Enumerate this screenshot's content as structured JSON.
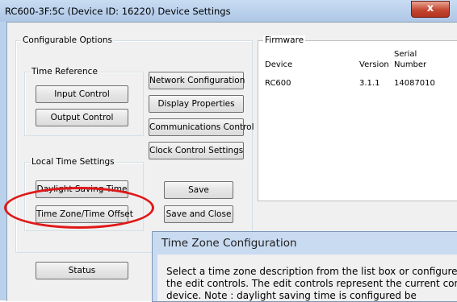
{
  "window": {
    "title": "RC600-3F:5C (Device ID: 16220) Device Settings",
    "close_glyph": "x"
  },
  "configurable_options": {
    "label": "Configurable Options"
  },
  "time_reference": {
    "label": "Time Reference",
    "input_control": "Input Control",
    "output_control": "Output Control"
  },
  "local_time_settings": {
    "label": "Local Time Settings",
    "daylight_saving": "Daylight Saving Time",
    "time_zone_offset": "Time Zone/Time Offset"
  },
  "right_buttons": {
    "network": "Network Configuration",
    "display": "Display Properties",
    "communications": "Communications Control",
    "clock": "Clock Control Settings",
    "save": "Save",
    "save_close": "Save and Close"
  },
  "status_button": "Status",
  "firmware": {
    "label": "Firmware",
    "headers": {
      "device": "Device",
      "version": "Version",
      "serial_line1": "Serial",
      "serial_line2": "Number"
    },
    "row": {
      "device": "RC600",
      "version": "3.1.1",
      "serial": "14087010"
    }
  },
  "annotation": {
    "color": "#e01818",
    "target": "Time Zone/Time Offset"
  },
  "dialog": {
    "title": "Time Zone Configuration",
    "line1": "Select a time zone description from the list box or configure a",
    "line2": "the edit controls.  The edit controls represent the current con",
    "line3": "device.  Note : daylight saving time is configured be"
  }
}
